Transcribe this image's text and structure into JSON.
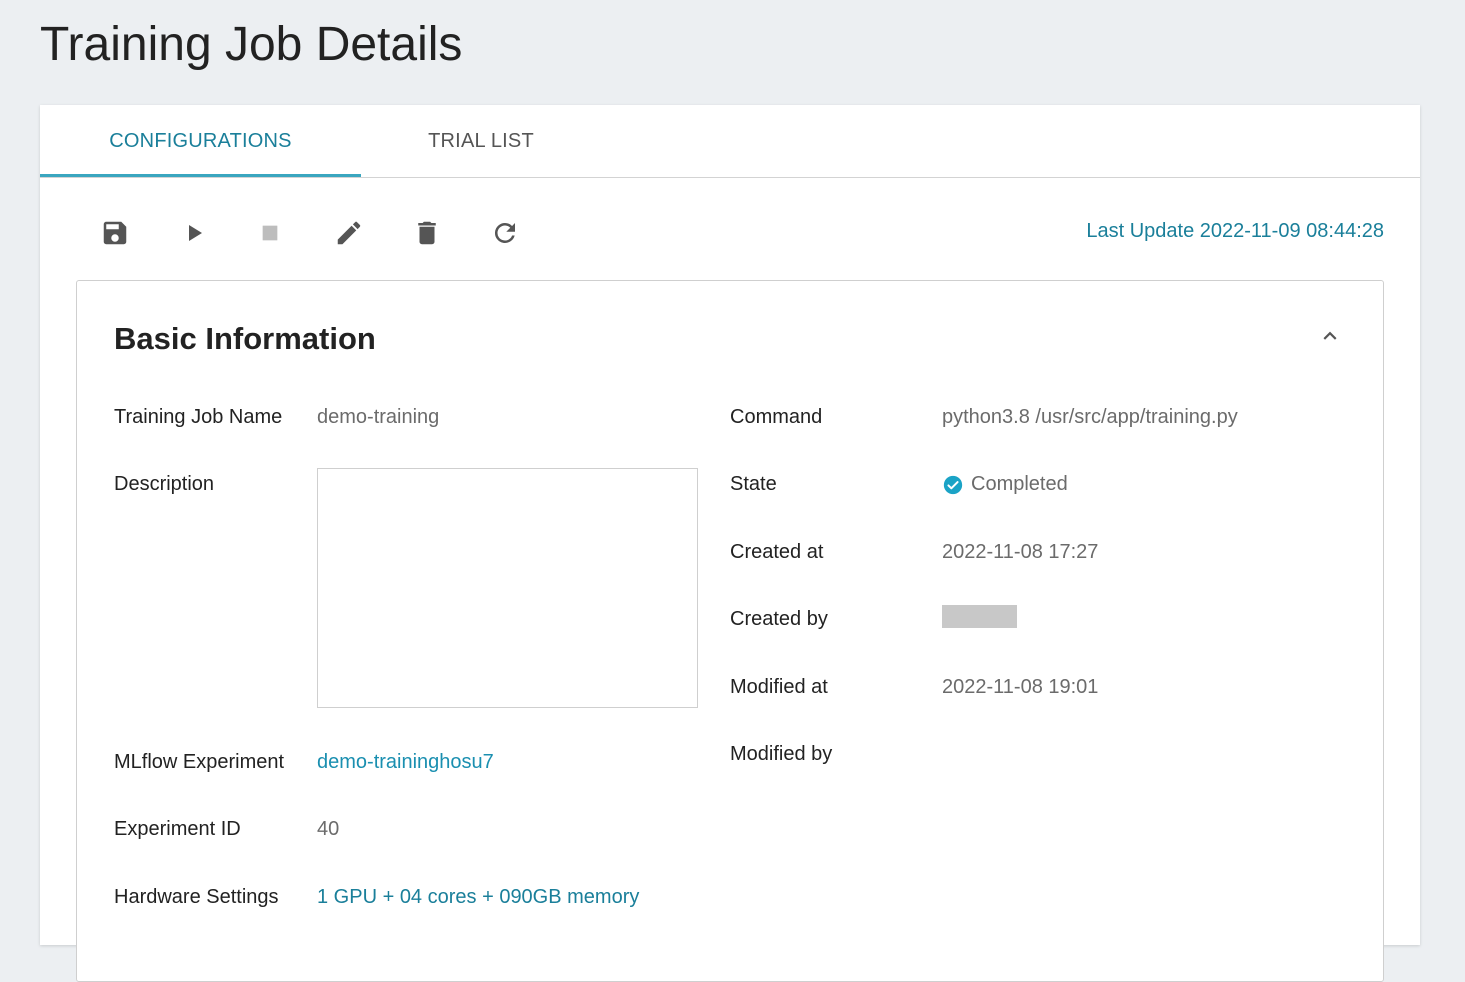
{
  "page": {
    "title": "Training Job Details"
  },
  "tabs": [
    {
      "label": "CONFIGURATIONS",
      "active": true
    },
    {
      "label": "TRIAL LIST",
      "active": false
    }
  ],
  "toolbar": {
    "buttons": [
      "save-icon",
      "play-icon",
      "stop-icon",
      "edit-icon",
      "delete-icon",
      "refresh-icon"
    ],
    "last_update": "Last Update 2022-11-09 08:44:28"
  },
  "basic_info": {
    "title": "Basic Information",
    "left": {
      "training_job_name": {
        "label": "Training Job Name",
        "value": "demo-training"
      },
      "description": {
        "label": "Description",
        "value": ""
      },
      "mlflow_experiment": {
        "label": "MLflow Experiment",
        "value": "demo-traininghosu7"
      },
      "experiment_id": {
        "label": "Experiment ID",
        "value": "40"
      },
      "hardware_settings": {
        "label": "Hardware Settings",
        "value": "1 GPU + 04 cores + 090GB memory"
      }
    },
    "right": {
      "command": {
        "label": "Command",
        "value": "python3.8 /usr/src/app/training.py"
      },
      "state": {
        "label": "State",
        "value": "Completed"
      },
      "created_at": {
        "label": "Created at",
        "value": "2022-11-08 17:27"
      },
      "created_by": {
        "label": "Created by"
      },
      "modified_at": {
        "label": "Modified at",
        "value": "2022-11-08 19:01"
      },
      "modified_by": {
        "label": "Modified by"
      }
    }
  },
  "colors": {
    "accent": "#1a7f9a",
    "link": "#1a8fb0",
    "state_ok": "#1ba3c6",
    "icon": "#555555",
    "icon_disabled": "#bdbdbd"
  }
}
